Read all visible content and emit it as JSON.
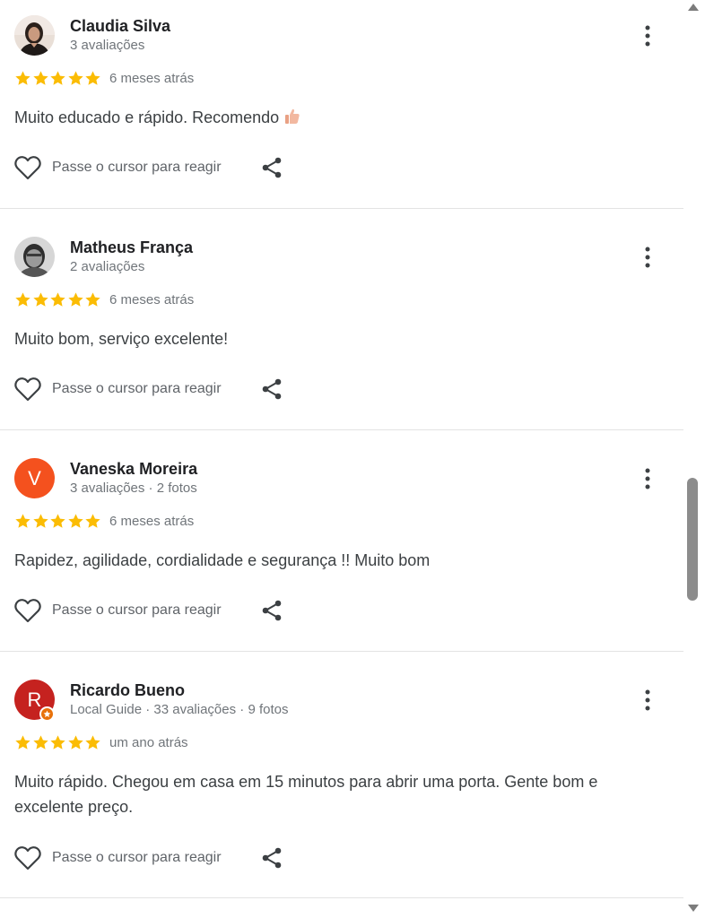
{
  "reviews": [
    {
      "name": "Claudia Silva",
      "meta": "3 avaliações",
      "rating": 5,
      "date": "6 meses atrás",
      "text": "Muito educado e rápido. Recomendo",
      "react_label": "Passe o cursor para reagir",
      "avatar": {
        "type": "photo"
      }
    },
    {
      "name": "Matheus França",
      "meta": "2 avaliações",
      "rating": 5,
      "date": "6 meses atrás",
      "text": "Muito bom, serviço excelente!",
      "react_label": "Passe o cursor para reagir",
      "avatar": {
        "type": "photo"
      }
    },
    {
      "name": "Vaneska Moreira",
      "meta": "3 avaliações · 2 fotos",
      "rating": 5,
      "date": "6 meses atrás",
      "text": "Rapidez, agilidade, cordialidade e segurança !! Muito bom",
      "react_label": "Passe o cursor para reagir",
      "avatar": {
        "type": "letter",
        "letter": "V",
        "color": "#f4511e"
      }
    },
    {
      "name": "Ricardo Bueno",
      "meta": "Local Guide · 33 avaliações · 9 fotos",
      "rating": 5,
      "date": "um ano atrás",
      "text": "Muito rápido. Chegou em casa em 15 minutos para abrir uma porta. Gente bom e excelente preço.",
      "react_label": "Passe o cursor para reagir",
      "avatar": {
        "type": "letter",
        "letter": "R",
        "color": "#c5221f",
        "local_guide_badge": true
      }
    }
  ],
  "colors": {
    "star": "#fbbc04",
    "text_primary": "#202124",
    "text_secondary": "#70757a",
    "divider": "#e3e3e3"
  },
  "icons": [
    "more-vertical-icon",
    "heart-icon",
    "share-icon",
    "star-icon",
    "thumbs-up-icon"
  ]
}
